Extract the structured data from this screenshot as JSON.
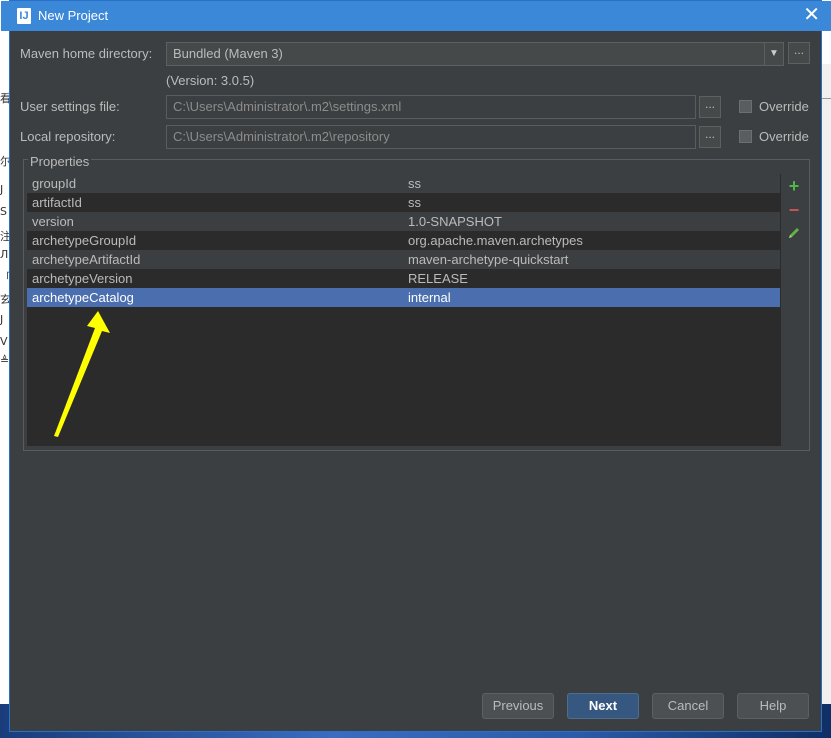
{
  "window": {
    "title": "New Project",
    "icon": "intellij-icon",
    "close_label": "✕"
  },
  "maven_home": {
    "label": "Maven home directory:",
    "value": "Bundled (Maven 3)",
    "version_text": "(Version: 3.0.5)",
    "browse_label": "..."
  },
  "user_settings": {
    "label": "User settings file:",
    "value": "C:\\Users\\Administrator\\.m2\\settings.xml",
    "browse_label": "...",
    "override_label": "Override",
    "override_checked": false
  },
  "local_repo": {
    "label": "Local repository:",
    "value": "C:\\Users\\Administrator\\.m2\\repository",
    "browse_label": "...",
    "override_label": "Override",
    "override_checked": false
  },
  "properties": {
    "legend": "Properties",
    "rows": [
      {
        "key": "groupId",
        "value": "ss"
      },
      {
        "key": "artifactId",
        "value": "ss"
      },
      {
        "key": "version",
        "value": "1.0-SNAPSHOT"
      },
      {
        "key": "archetypeGroupId",
        "value": "org.apache.maven.archetypes"
      },
      {
        "key": "archetypeArtifactId",
        "value": "maven-archetype-quickstart"
      },
      {
        "key": "archetypeVersion",
        "value": "RELEASE"
      },
      {
        "key": "archetypeCatalog",
        "value": "internal"
      }
    ],
    "selected_index": 6,
    "toolbar": {
      "add": "+",
      "remove": "−"
    }
  },
  "buttons": {
    "previous": "Previous",
    "next": "Next",
    "cancel": "Cancel",
    "help": "Help"
  },
  "annotation": {
    "arrow_color": "#ffff00"
  },
  "colors": {
    "dialog_bg": "#3c3f41",
    "titlebar": "#3b87d8",
    "selection": "#4b6eaf",
    "add": "#4fb84a",
    "remove": "#c75450"
  }
}
